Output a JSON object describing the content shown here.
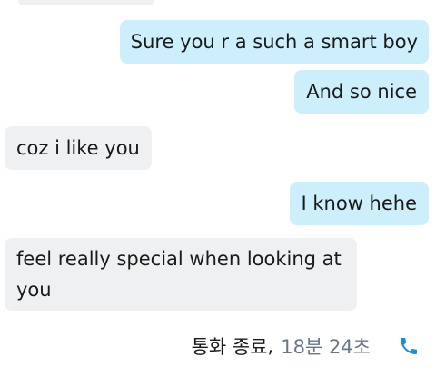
{
  "messages": [
    {
      "direction": "outgoing",
      "text": "Sure you r a such a smart boy"
    },
    {
      "direction": "outgoing",
      "text": "And so nice"
    },
    {
      "direction": "incoming",
      "text": "coz i like you"
    },
    {
      "direction": "outgoing",
      "text": "I know hehe"
    },
    {
      "direction": "incoming",
      "text": "feel really special when looking at you"
    }
  ],
  "call": {
    "status": "통화 종료",
    "separator": ",",
    "duration": "18분 24초",
    "icon": "phone-icon"
  },
  "colors": {
    "outgoing_bubble": "#cdeefb",
    "incoming_bubble": "#eef0f2",
    "duration_text": "#6a7784",
    "phone_icon": "#1a8fd8"
  }
}
